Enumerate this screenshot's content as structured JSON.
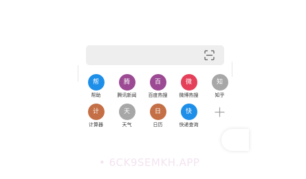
{
  "search": {
    "placeholder": ""
  },
  "shortcuts": {
    "row1": [
      {
        "glyph": "帮",
        "label": "帮助",
        "color": "#1e8fe8"
      },
      {
        "glyph": "腾",
        "label": "腾讯新闻",
        "color": "#9b4a93"
      },
      {
        "glyph": "百",
        "label": "百度热搜",
        "color": "#9b4a93"
      },
      {
        "glyph": "微",
        "label": "微博热搜",
        "color": "#e5405a"
      },
      {
        "glyph": "知",
        "label": "知乎",
        "color": "#a7a7a7"
      }
    ],
    "row2": [
      {
        "glyph": "计",
        "label": "计算器",
        "color": "#c46f45"
      },
      {
        "glyph": "天",
        "label": "天气",
        "color": "#a7a7a7"
      },
      {
        "glyph": "日",
        "label": "日历",
        "color": "#c46f45"
      },
      {
        "glyph": "快",
        "label": "快递查询",
        "color": "#1e8fe8"
      },
      {
        "glyph": "+",
        "label": "",
        "icon": "plus-icon",
        "color": "#9e9e9e"
      }
    ]
  },
  "watermark": "• 6CK9SEMKH.APP"
}
